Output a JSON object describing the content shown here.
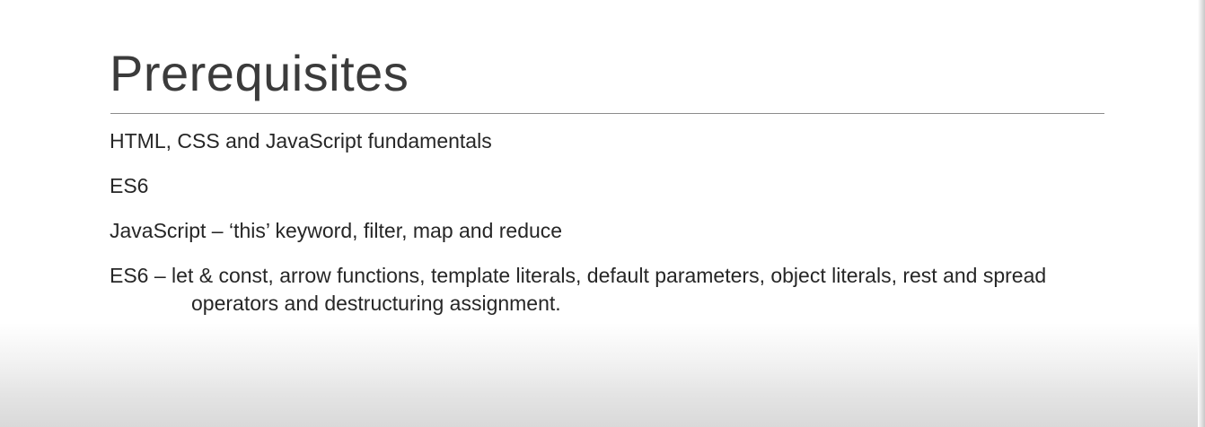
{
  "slide": {
    "title": "Prerequisites",
    "items": [
      "HTML, CSS and JavaScript fundamentals",
      "ES6",
      "JavaScript – ‘this’ keyword, filter, map and reduce",
      "ES6 – let & const, arrow functions, template literals, default parameters, object literals, rest and spread operators and destructuring assignment."
    ]
  }
}
